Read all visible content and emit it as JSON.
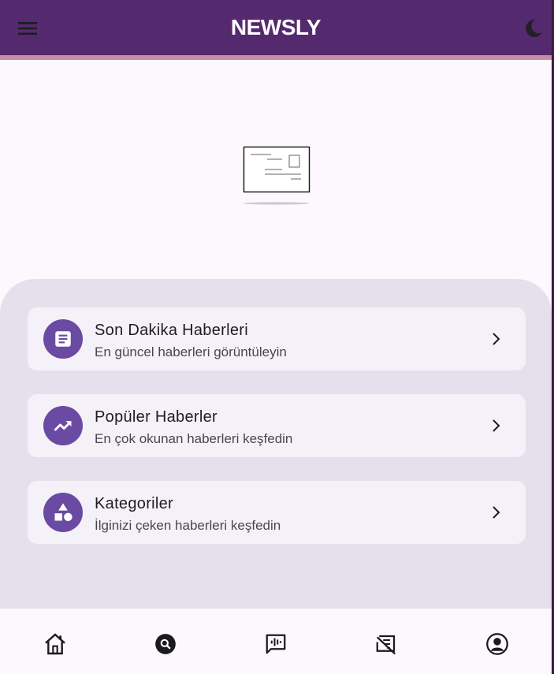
{
  "app": {
    "title": "NEWSLY"
  },
  "colors": {
    "app_bar": "#55296e",
    "accent_stripe": "#c98aa6",
    "icon_circle": "#6b4aa3",
    "panel": "#e6dfec",
    "card": "#f5f1f8",
    "background": "#fdf7fe"
  },
  "header": {
    "menu_icon": "hamburger-menu-icon",
    "theme_icon": "moon-icon"
  },
  "hero": {
    "icon": "news-placeholder-illustration"
  },
  "menu": {
    "items": [
      {
        "icon": "article-icon",
        "title": "Son Dakika Haberleri",
        "subtitle": "En güncel haberleri görüntüleyin"
      },
      {
        "icon": "trending-up-icon",
        "title": "Popüler Haberler",
        "subtitle": "En çok okunan haberleri keşfedin"
      },
      {
        "icon": "category-icon",
        "title": "Kategoriler",
        "subtitle": "İlginizi çeken haberleri keşfedin"
      }
    ]
  },
  "bottom_nav": {
    "items": [
      {
        "icon": "home-icon"
      },
      {
        "icon": "search-icon"
      },
      {
        "icon": "voice-chat-icon"
      },
      {
        "icon": "no-newspaper-icon"
      },
      {
        "icon": "account-icon"
      }
    ]
  }
}
